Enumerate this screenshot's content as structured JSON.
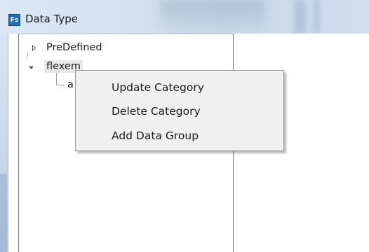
{
  "window": {
    "title": "Data Type",
    "app_icon_text": "Fs"
  },
  "tree": {
    "items": [
      {
        "label": "PreDefined",
        "expanded": false,
        "icon": "expander-collapsed-icon"
      },
      {
        "label": "flexem",
        "expanded": true,
        "selected": true,
        "icon": "expander-expanded-icon",
        "children": [
          {
            "label": "a"
          }
        ]
      }
    ]
  },
  "context_menu": {
    "items": [
      {
        "label": "Update Category"
      },
      {
        "label": "Delete Category"
      },
      {
        "label": "Add Data Group"
      }
    ]
  },
  "colors": {
    "titlebar": "#d3e0ef",
    "menu_background": "#f0f0f0",
    "app_icon": "#1f6fb5"
  }
}
